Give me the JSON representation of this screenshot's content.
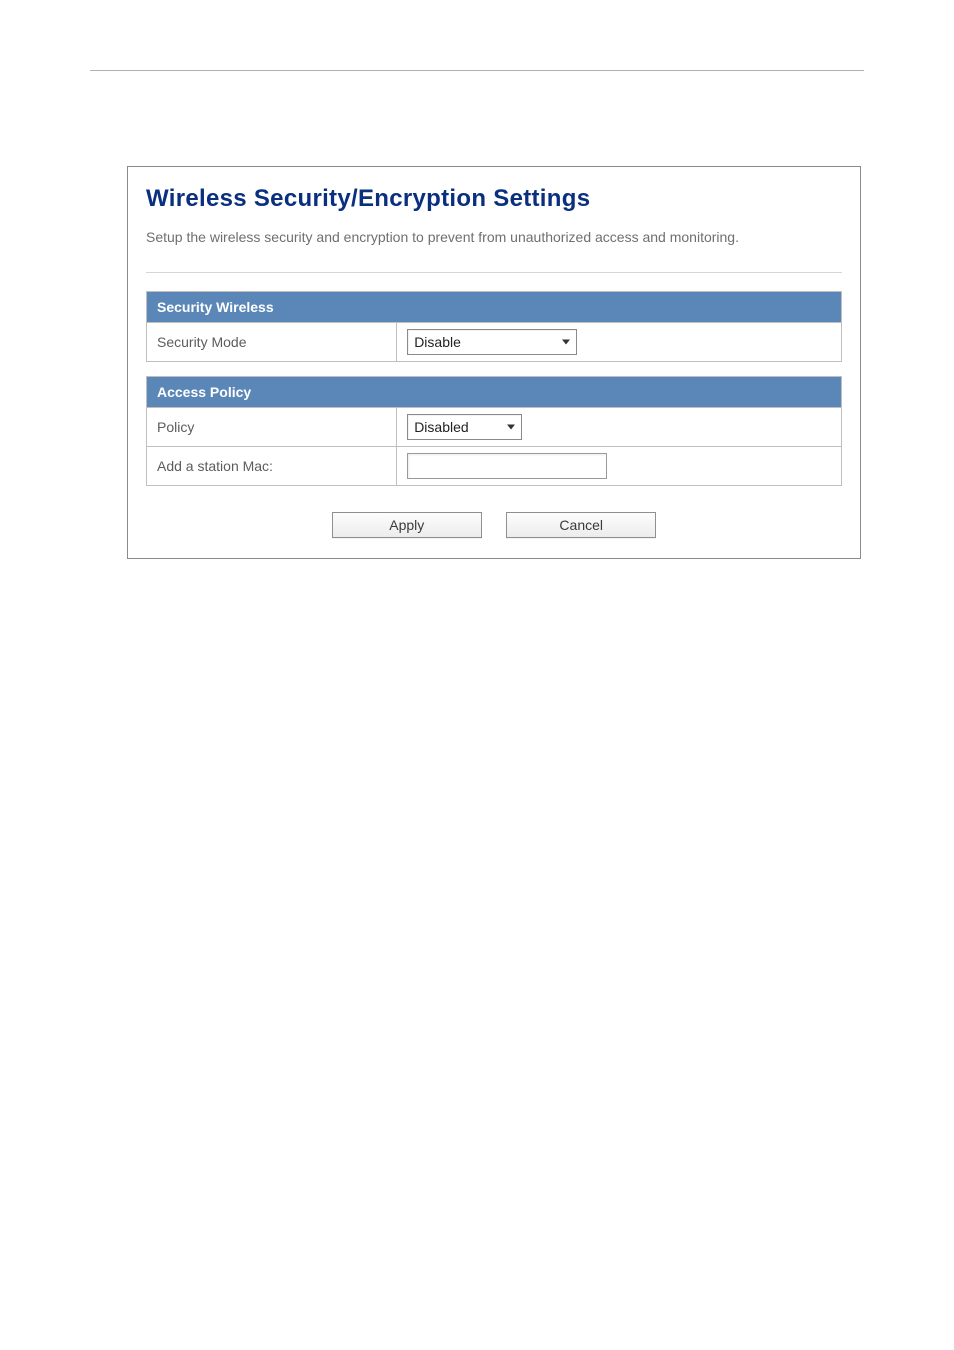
{
  "panel": {
    "title": "Wireless Security/Encryption Settings",
    "description": "Setup the wireless security and encryption to prevent from unauthorized access and monitoring."
  },
  "securityWireless": {
    "header": "Security Wireless",
    "securityModeLabel": "Security Mode",
    "securityModeValue": "Disable"
  },
  "accessPolicy": {
    "header": "Access Policy",
    "policyLabel": "Policy",
    "policyValue": "Disabled",
    "addStationLabel": "Add a station Mac:",
    "addStationValue": ""
  },
  "buttons": {
    "apply": "Apply",
    "cancel": "Cancel"
  }
}
